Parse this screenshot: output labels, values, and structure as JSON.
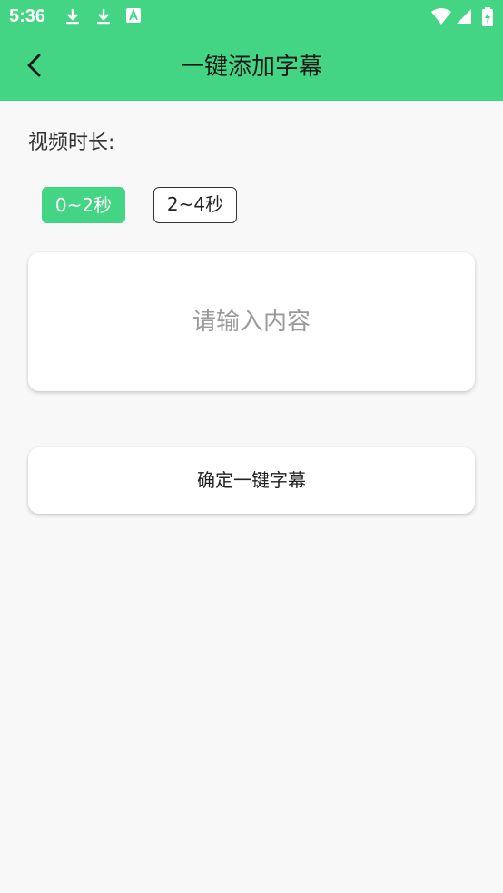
{
  "status_bar": {
    "time": "5:36",
    "icons": [
      "download-icon",
      "download-icon",
      "text-notification-icon",
      "wifi-icon",
      "cellular-signal-icon",
      "battery-charging-icon"
    ]
  },
  "app_bar": {
    "back_icon": "chevron-left-icon",
    "title": "一键添加字幕"
  },
  "duration": {
    "label": "视频时长:",
    "options": [
      {
        "label": "0~2秒",
        "selected": true
      },
      {
        "label": "2~4秒",
        "selected": false
      }
    ]
  },
  "content_input": {
    "value": "",
    "placeholder": "请输入内容"
  },
  "confirm_button": {
    "label": "确定一键字幕"
  },
  "colors": {
    "accent": "#43d584",
    "background": "#f8f8f8",
    "card": "#ffffff",
    "title_text": "#1a1a1a",
    "placeholder": "#9a9a9a"
  }
}
